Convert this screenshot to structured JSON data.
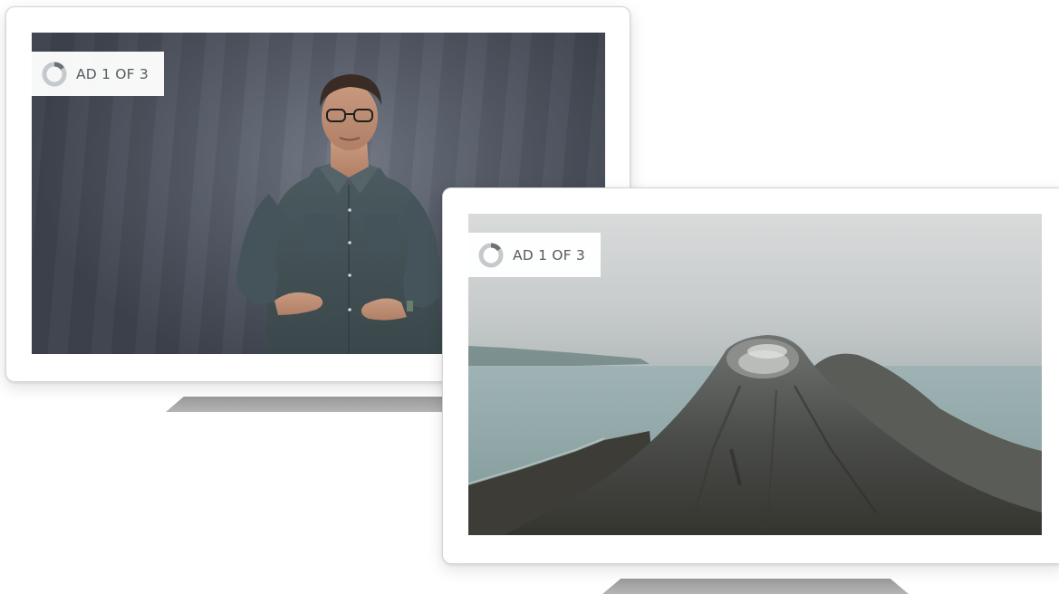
{
  "tv_left": {
    "ad_badge": {
      "label": "AD 1 OF 3",
      "icon": "ad-progress-ring-icon",
      "progress_fraction": 0.15
    },
    "video": {
      "scene": "presenter-in-front-of-grey-backdrop"
    }
  },
  "tv_right": {
    "ad_badge": {
      "label": "AD 1 OF 3",
      "icon": "ad-progress-ring-icon",
      "progress_fraction": 0.15
    },
    "video": {
      "scene": "aerial-volcano-landscape"
    }
  },
  "colors": {
    "badge_background": "#ffffff",
    "badge_text": "#555b5f",
    "ring_track": "#c5c9cc",
    "ring_progress": "#6c7175",
    "bezel": "#ffffff",
    "stand": "#a8a8a8"
  }
}
